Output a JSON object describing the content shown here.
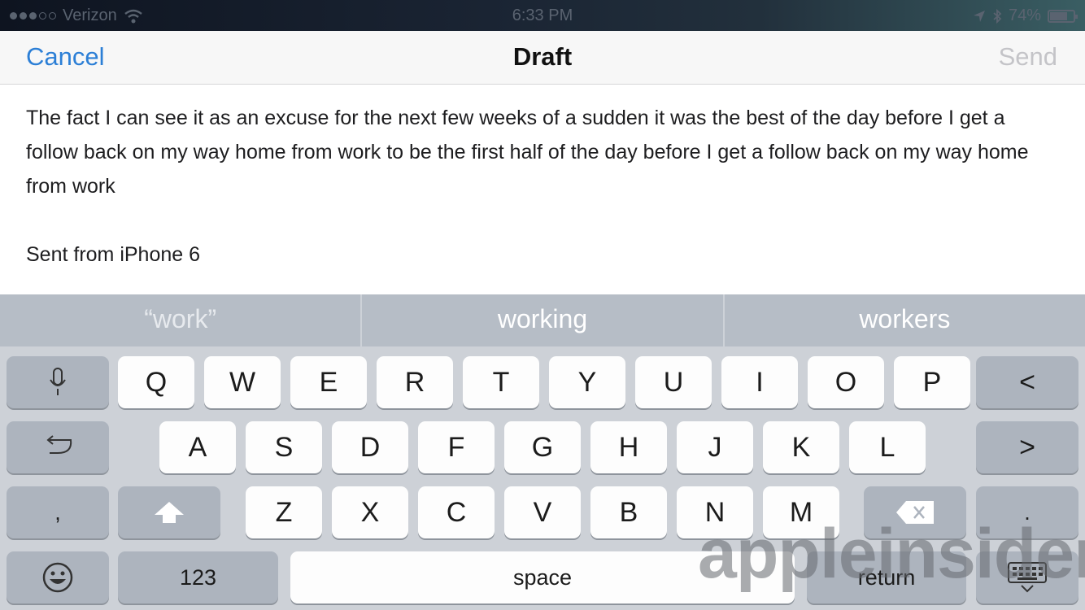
{
  "status_bar": {
    "carrier": "Verizon",
    "time": "6:33 PM",
    "battery": "74%",
    "battery_level": 0.74
  },
  "nav": {
    "cancel_label": "Cancel",
    "title": "Draft",
    "send_label": "Send"
  },
  "message": {
    "body": "The fact I can see it as an excuse for the next few weeks of a sudden it was the best of the day before I get a follow back on my way home from work to be the first half of the day before I get a follow back on my way home from work",
    "signature": "Sent from iPhone 6"
  },
  "keyboard": {
    "suggestions": [
      "“work”",
      "working",
      "workers"
    ],
    "row1": [
      "Q",
      "W",
      "E",
      "R",
      "T",
      "Y",
      "U",
      "I",
      "O",
      "P"
    ],
    "row2": [
      "A",
      "S",
      "D",
      "F",
      "G",
      "H",
      "J",
      "K",
      "L"
    ],
    "row3": [
      "Z",
      "X",
      "C",
      "V",
      "B",
      "N",
      "M"
    ],
    "left_arrow": "<",
    "right_arrow": ">",
    "comma": ",",
    "period": ".",
    "numbers_label": "123",
    "space_label": "space",
    "return_label": "return"
  },
  "watermark": "appleinsider",
  "colors": {
    "accent": "#2c7fd6",
    "disabled": "#c4c4c8",
    "keyboard_bg": "#cdd1d7",
    "suggestion_bar": "#b6bdc6"
  },
  "icons": [
    "wifi-icon",
    "location-icon",
    "bluetooth-icon",
    "battery-icon",
    "microphone-icon",
    "undo-icon",
    "shift-icon",
    "backspace-icon",
    "emoji-icon",
    "dismiss-keyboard-icon"
  ]
}
